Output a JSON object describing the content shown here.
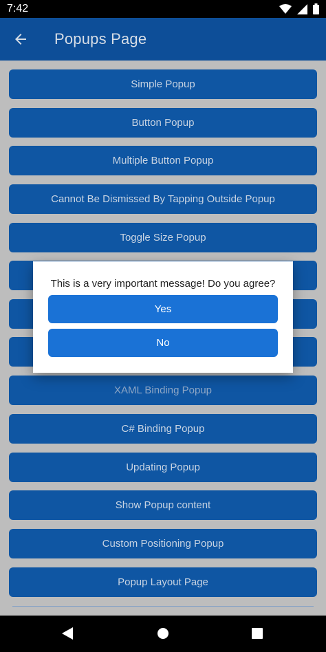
{
  "status_bar": {
    "time": "7:42",
    "icons": [
      "wifi-icon",
      "signal-icon",
      "battery-icon"
    ]
  },
  "app_bar": {
    "title": "Popups Page",
    "back_icon": "arrow-left-icon",
    "background": "#0d4e98"
  },
  "buttons": [
    {
      "label": "Simple Popup"
    },
    {
      "label": "Button Popup"
    },
    {
      "label": "Multiple Button Popup"
    },
    {
      "label": "Cannot Be Dismissed By Tapping Outside Popup"
    },
    {
      "label": "Toggle Size Popup"
    },
    {
      "label": ""
    },
    {
      "label": ""
    },
    {
      "label": ""
    },
    {
      "label": "XAML Binding Popup"
    },
    {
      "label": "C# Binding Popup"
    },
    {
      "label": "Updating Popup"
    },
    {
      "label": "Show Popup content"
    },
    {
      "label": "Custom Positioning Popup"
    },
    {
      "label": "Popup Layout Page"
    }
  ],
  "dialog": {
    "message": "This is a very important message! Do you agree?",
    "yes_label": "Yes",
    "no_label": "No",
    "accent": "#1a72d6"
  },
  "nav_bar": {
    "icons": [
      "back-triangle-icon",
      "home-circle-icon",
      "recents-square-icon"
    ]
  }
}
